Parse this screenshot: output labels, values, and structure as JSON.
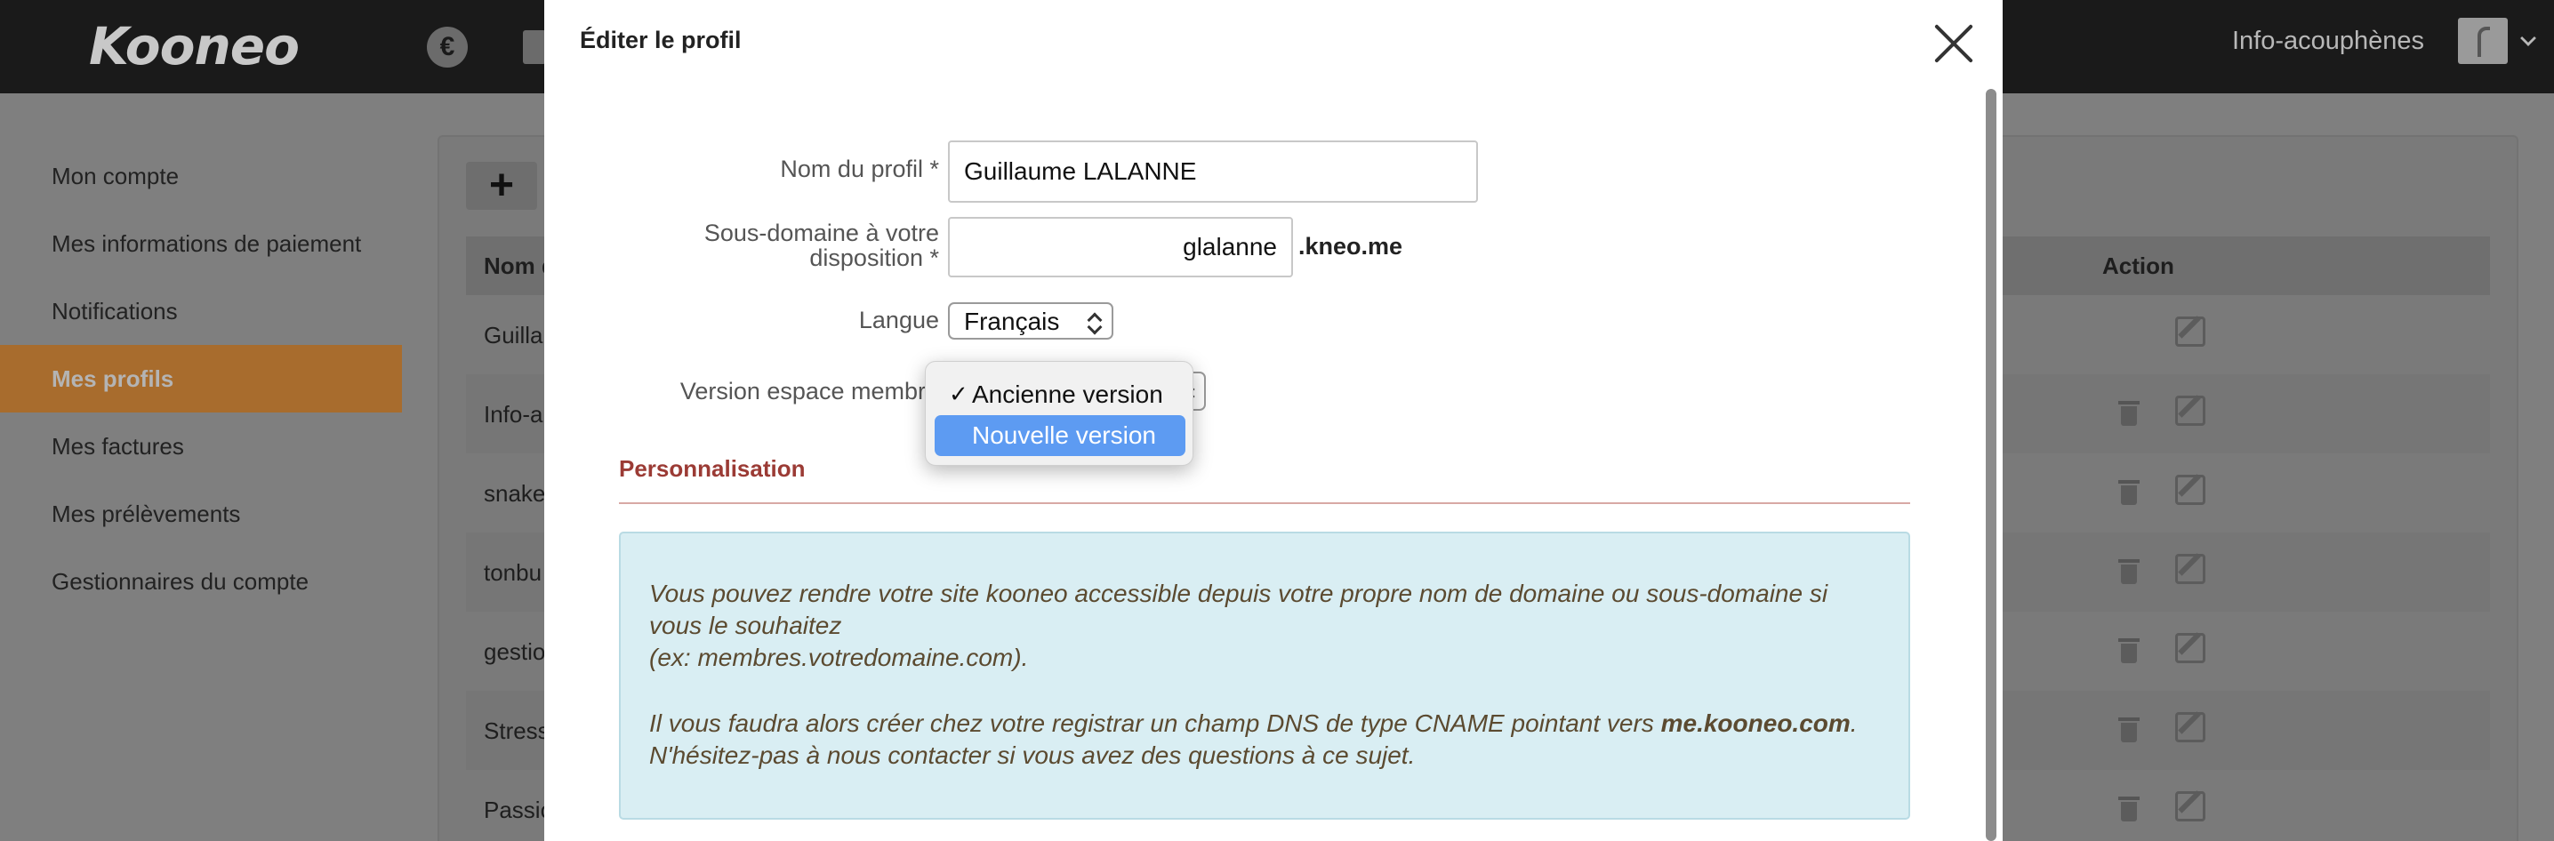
{
  "app": {
    "logo": "Kooneo",
    "account_name": "Info-acouphènes",
    "currency_icon": "€"
  },
  "sidebar": {
    "items": [
      {
        "label": "Mon compte"
      },
      {
        "label": "Mes informations de paiement"
      },
      {
        "label": "Notifications"
      },
      {
        "label": "Mes profils",
        "active": true
      },
      {
        "label": "Mes factures"
      },
      {
        "label": "Mes prélèvements"
      },
      {
        "label": "Gestionnaires du compte"
      }
    ]
  },
  "profiles_table": {
    "add_label": "+",
    "col_name": "Nom d",
    "col_action": "Action",
    "rows": [
      {
        "name": "Guilla"
      },
      {
        "name": "Info-a"
      },
      {
        "name": "snake"
      },
      {
        "name": "tonbu"
      },
      {
        "name": "gestio"
      },
      {
        "name": "Stress"
      },
      {
        "name": "Passio"
      }
    ]
  },
  "modal": {
    "title": "Éditer le profil",
    "fields": {
      "profile_name_label": "Nom du profil *",
      "profile_name_value": "Guillaume LALANNE",
      "subdomain_label_line1": "Sous-domaine à votre",
      "subdomain_label_line2": "disposition *",
      "subdomain_value": "glalanne",
      "subdomain_suffix": ".kneo.me",
      "language_label": "Langue",
      "language_value": "Français",
      "version_label": "Version espace membre"
    },
    "version_dropdown": {
      "options": [
        {
          "label": "Ancienne version",
          "checked": true
        },
        {
          "label": "Nouvelle version",
          "highlighted": true
        }
      ]
    },
    "personalisation": {
      "title": "Personnalisation",
      "info_line1": "Vous pouvez rendre votre site kooneo accessible depuis votre propre nom de domaine ou sous-domaine si vous le souhaitez",
      "info_line2": "(ex: membres.votredomaine.com).",
      "info_line3_prefix": "Il vous faudra alors créer chez votre registrar un champ DNS de type CNAME pointant vers ",
      "info_line3_domain": "me.kooneo.com",
      "info_line3_suffix": ".",
      "info_line4": "N'hésitez-pas à nous contacter si vous avez des questions à ce sujet."
    }
  },
  "colors": {
    "overlay_dim": "#7f7f7f",
    "active_sidebar": "#a86c2d",
    "section_title": "#9b3b35",
    "info_box_bg": "#d9eef3",
    "dropdown_highlight": "#5d9bf2"
  }
}
